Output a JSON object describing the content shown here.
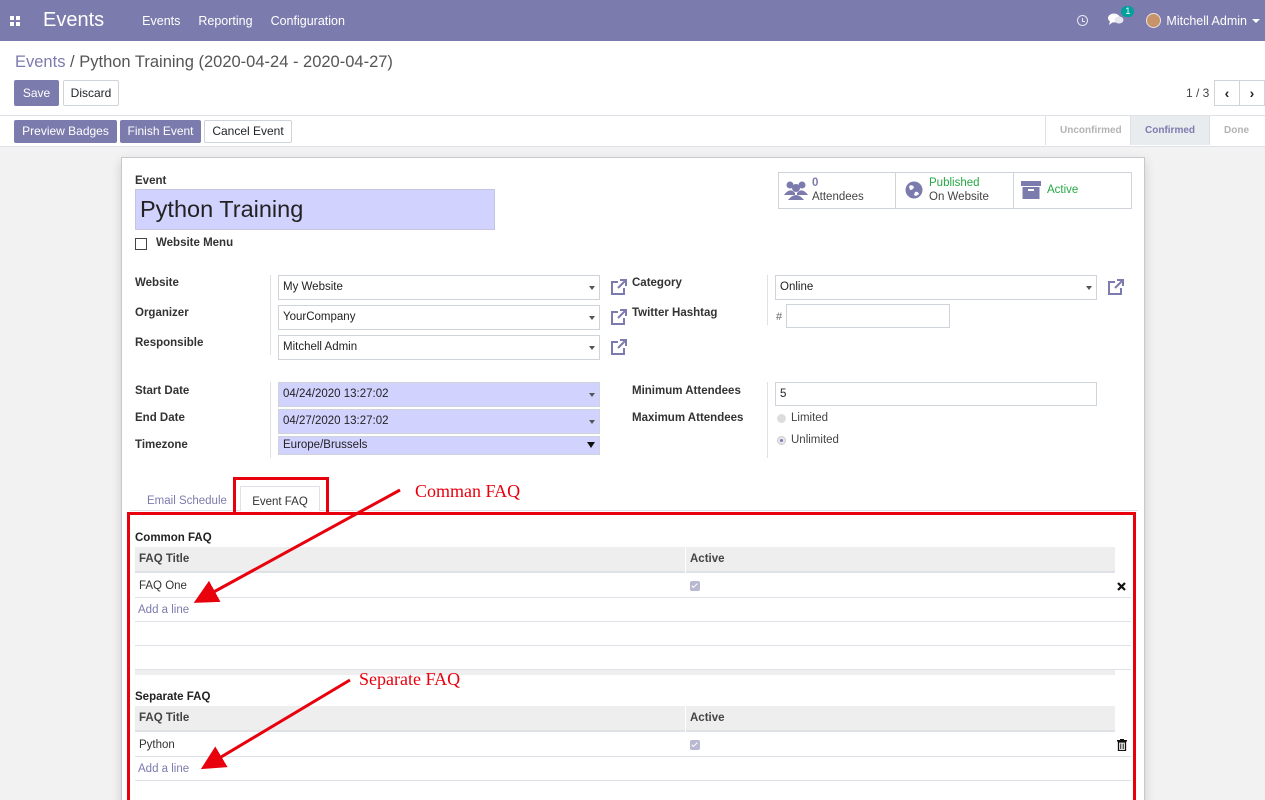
{
  "navbar": {
    "app_name": "Events",
    "menu": [
      "Events",
      "Reporting",
      "Configuration"
    ],
    "chat_badge": "1",
    "user_name": "Mitchell Admin"
  },
  "control_panel": {
    "breadcrumb_parent": "Events",
    "breadcrumb_separator": "/",
    "breadcrumb_current": "Python Training (2020-04-24 - 2020-04-27)",
    "save_label": "Save",
    "discard_label": "Discard",
    "pager": "1 / 3"
  },
  "header_buttons": {
    "preview_badges": "Preview Badges",
    "finish_event": "Finish Event",
    "cancel_event": "Cancel Event"
  },
  "stages": {
    "unconfirmed": "Unconfirmed",
    "confirmed": "Confirmed",
    "done": "Done",
    "active_stage": "Confirmed"
  },
  "smart_buttons": {
    "attendees_count": "0",
    "attendees_label": "Attendees",
    "published_label": "Published",
    "on_website_label": "On Website",
    "active_label": "Active"
  },
  "form": {
    "event_label": "Event",
    "event_name": "Python Training",
    "website_menu_label": "Website Menu",
    "website_label": "Website",
    "website_value": "My Website",
    "organizer_label": "Organizer",
    "organizer_value": "YourCompany",
    "responsible_label": "Responsible",
    "responsible_value": "Mitchell Admin",
    "category_label": "Category",
    "category_value": "Online",
    "twitter_label": "Twitter Hashtag",
    "hash_prefix": "#",
    "start_date_label": "Start Date",
    "start_date_value": "04/24/2020 13:27:02",
    "end_date_label": "End Date",
    "end_date_value": "04/27/2020 13:27:02",
    "timezone_label": "Timezone",
    "timezone_value": "Europe/Brussels",
    "min_attendees_label": "Minimum Attendees",
    "min_attendees_value": "5",
    "max_attendees_label": "Maximum Attendees",
    "limited_label": "Limited",
    "unlimited_label": "Unlimited"
  },
  "tabs": {
    "email_schedule": "Email Schedule",
    "event_faq": "Event FAQ"
  },
  "common_faq": {
    "title": "Common FAQ",
    "col_title": "FAQ Title",
    "col_active": "Active",
    "rows": [
      {
        "title": "FAQ One",
        "active": true
      }
    ],
    "add_line": "Add a line"
  },
  "separate_faq": {
    "title": "Separate FAQ",
    "col_title": "FAQ Title",
    "col_active": "Active",
    "rows": [
      {
        "title": "Python",
        "active": true
      }
    ],
    "add_line": "Add a line"
  },
  "annotations": {
    "common": "Comman FAQ",
    "separate": "Separate FAQ"
  },
  "colors": {
    "brand": "#7c7bad",
    "annotation_red": "#e8000d",
    "required_field": "#d2d2ff",
    "published_green": "#28a745"
  }
}
